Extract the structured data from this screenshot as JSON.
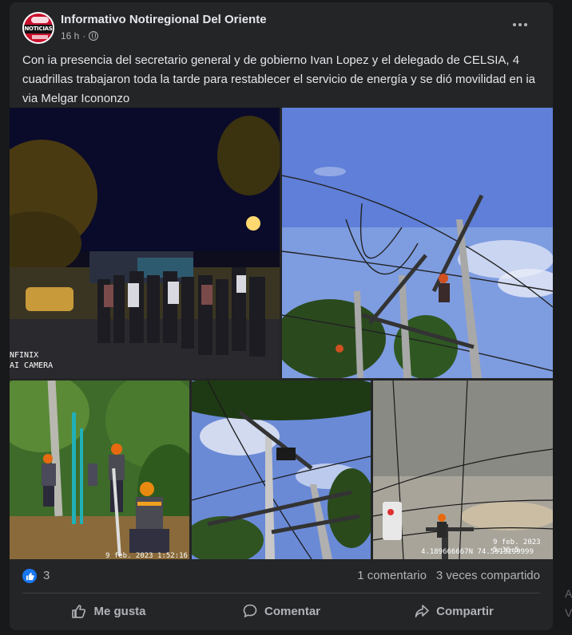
{
  "post": {
    "page_name": "Informativo Notiregional Del Oriente",
    "avatar_text": "NOTICIAS",
    "time": "16 h",
    "separator": "·",
    "text": "Con ia presencia del secretario general y de gobierno Ivan Lopez y el delegado de CELSIA,  4 cuadrillas trabajaron toda la tarde para restablecer el servicio de energía y se dió  movilidad en ia via Melgar Icononzo"
  },
  "photos": {
    "photo1_watermark_line1": "NFINIX",
    "photo1_watermark_line2": "AI CAMERA",
    "photo3_watermark": "9 feb. 2023 1:52:16 p.m.",
    "photo5_watermark_line1": "9 feb. 2023 5:36:5",
    "photo5_watermark_line2": "4.189666667N 74.5913299999"
  },
  "footer": {
    "like_count": "3",
    "comments": "1 comentario",
    "shares": "3 veces compartido",
    "like_label": "Me gusta",
    "comment_label": "Comentar",
    "share_label": "Compartir"
  },
  "edge": {
    "char1": "A",
    "char2": "V"
  },
  "colors": {
    "background": "#18191a",
    "card": "#242526",
    "accent": "#1877f2",
    "text": "#e4e6eb",
    "muted": "#b0b3b8"
  }
}
